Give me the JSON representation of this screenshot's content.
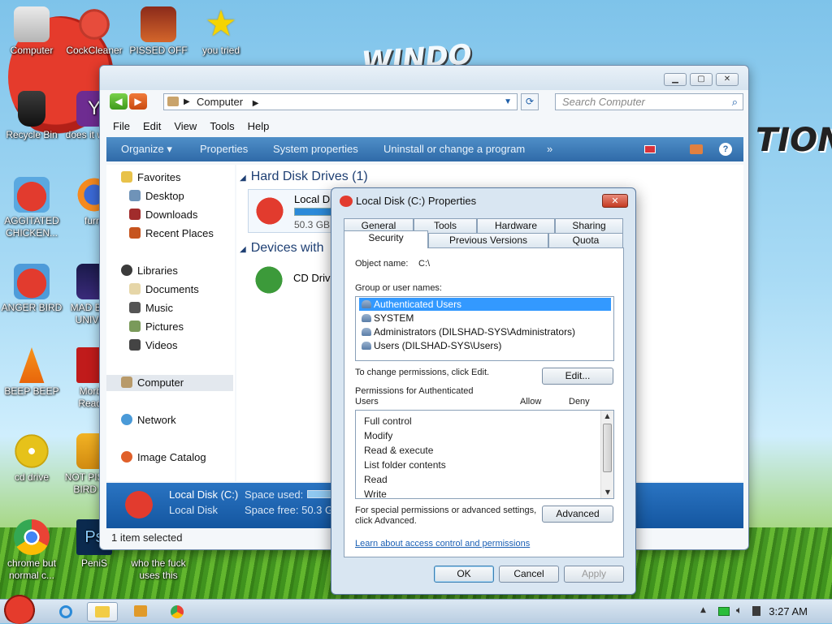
{
  "desktop": {
    "icons": [
      {
        "label": "Computer"
      },
      {
        "label": "CockCleaner"
      },
      {
        "label": "PISSED OFF"
      },
      {
        "label": "you tried"
      },
      {
        "label": "Recycle Bin"
      },
      {
        "label": "does it work?"
      },
      {
        "label": "AGGITATED CHICKEN..."
      },
      {
        "label": "furry"
      },
      {
        "label": "ANGER BIRD"
      },
      {
        "label": "MAD BIRD UNIVE..."
      },
      {
        "label": "BEEP BEEP"
      },
      {
        "label": "Morbid Reader"
      },
      {
        "label": "cd drive"
      },
      {
        "label": "NOT PISSED BIRD G..."
      },
      {
        "label": "chrome but normal c..."
      },
      {
        "label": "PeniS"
      },
      {
        "label": "who the fuck uses this"
      }
    ]
  },
  "explorer": {
    "address": "Computer",
    "search_placeholder": "Search Computer",
    "menu": [
      "File",
      "Edit",
      "View",
      "Tools",
      "Help"
    ],
    "commands": [
      "Organize ▾",
      "Properties",
      "System properties",
      "Uninstall or change a program",
      "»"
    ],
    "nav": {
      "favorites": "Favorites",
      "desktop": "Desktop",
      "downloads": "Downloads",
      "recent": "Recent Places",
      "libraries": "Libraries",
      "documents": "Documents",
      "music": "Music",
      "pictures": "Pictures",
      "videos": "Videos",
      "computer": "Computer",
      "network": "Network",
      "image_catalog": "Image Catalog"
    },
    "groups": {
      "hdd": "Hard Disk Drives (1)",
      "hdd_item": "Local Di",
      "hdd_size": "50.3 GB",
      "removable": "Devices with",
      "cd_item": "CD Drive"
    },
    "details": {
      "name": "Local Disk (C:)",
      "type": "Local Disk",
      "used_label": "Space used:",
      "free_label": "Space free: 50.3 G"
    },
    "status": "1 item selected"
  },
  "dialog": {
    "title": "Local Disk (C:) Properties",
    "tabs_row1": [
      "General",
      "Tools",
      "Hardware",
      "Sharing"
    ],
    "tabs_row2": [
      "Security",
      "Previous Versions",
      "Quota"
    ],
    "object_name_label": "Object name:",
    "object_name_value": "C:\\",
    "group_label": "Group or user names:",
    "users": [
      "Authenticated Users",
      "SYSTEM",
      "Administrators (DILSHAD-SYS\\Administrators)",
      "Users (DILSHAD-SYS\\Users)"
    ],
    "change_perms_text": "To change permissions, click Edit.",
    "edit_button": "Edit...",
    "perms_for_line1": "Permissions for Authenticated",
    "perms_for_line2": "Users",
    "allow_label": "Allow",
    "deny_label": "Deny",
    "permissions": [
      "Full control",
      "Modify",
      "Read & execute",
      "List folder contents",
      "Read",
      "Write"
    ],
    "special_line1": "For special permissions or advanced settings,",
    "special_line2": "click Advanced.",
    "advanced_button": "Advanced",
    "learn_link": "Learn about access control and permissions",
    "ok": "OK",
    "cancel": "Cancel",
    "apply": "Apply"
  },
  "taskbar": {
    "clock": "3:27 AM"
  }
}
